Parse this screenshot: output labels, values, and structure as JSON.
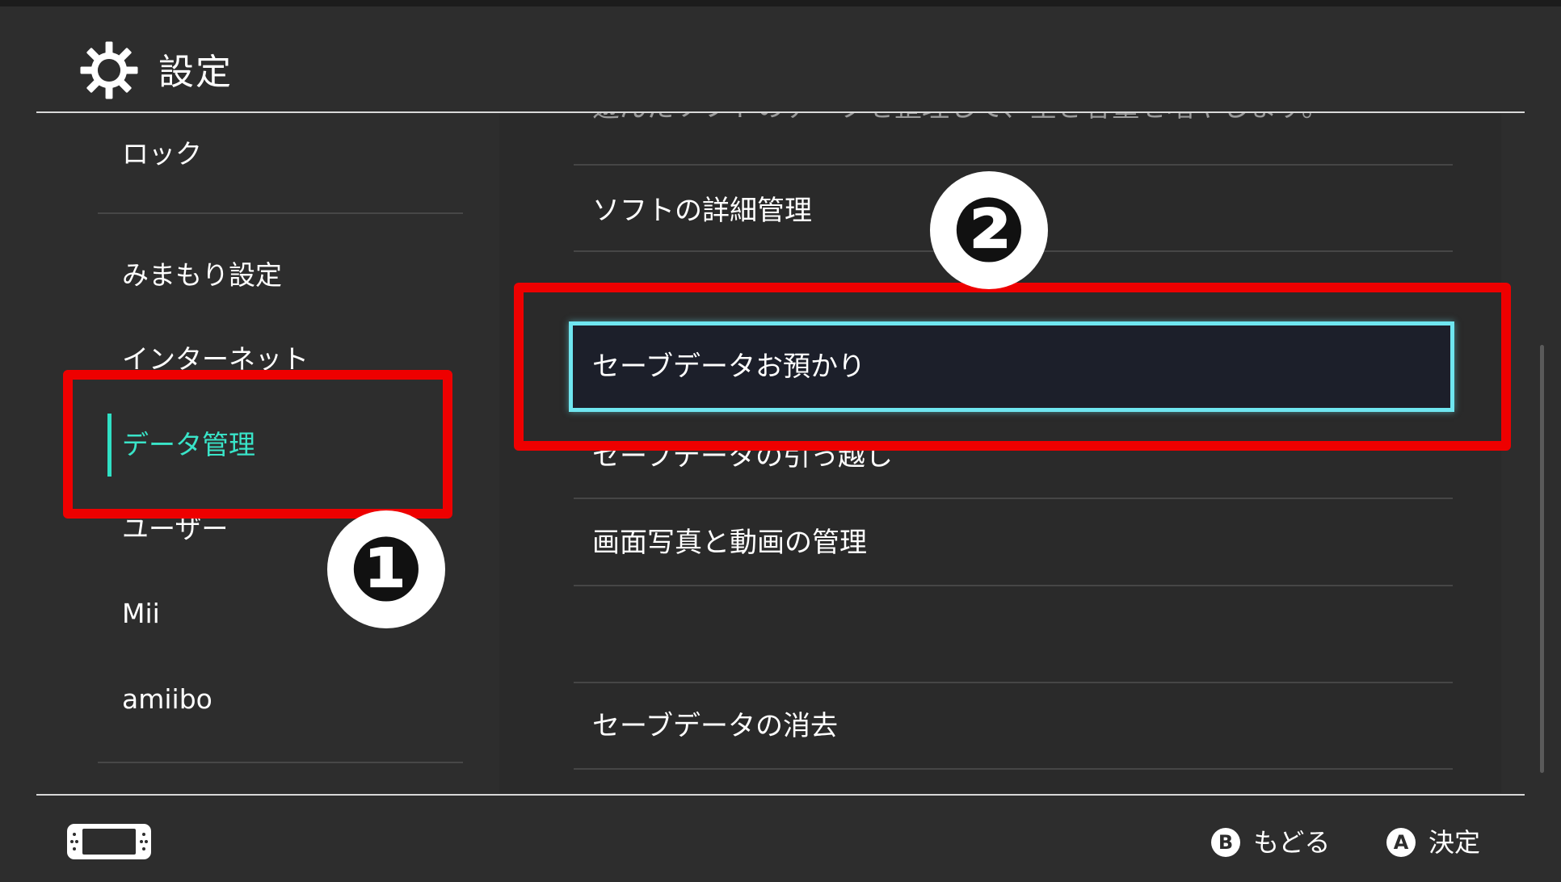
{
  "header": {
    "title": "設定",
    "icon": "gear-icon"
  },
  "sidebar": {
    "items": [
      {
        "label": "ロック"
      },
      {
        "label": "みまもり設定"
      },
      {
        "label": "インターネット"
      },
      {
        "label": "データ管理",
        "active": true
      },
      {
        "label": "ユーザー"
      },
      {
        "label": "Mii"
      },
      {
        "label": "amiibo"
      }
    ]
  },
  "content": {
    "cut_off_text": "遊んだソフトのデータを整理して、空き容量を増やします。",
    "items": [
      {
        "label": "ソフトの詳細管理"
      },
      {
        "label": "セーブデータお預かり",
        "selected": true
      },
      {
        "label": "セーブデータの引っ越し"
      },
      {
        "label": "画面写真と動画の管理"
      },
      {
        "label": "セーブデータの消去"
      }
    ]
  },
  "annotations": {
    "badge1": "❶",
    "badge2": "❷",
    "highlight_color": "#ee0000"
  },
  "footer": {
    "console_icon": "switch-console-icon",
    "back": {
      "button": "B",
      "label": "もどる"
    },
    "confirm": {
      "button": "A",
      "label": "決定"
    }
  },
  "colors": {
    "background": "#2d2d2d",
    "accent": "#39e4c8",
    "selection_border": "#6fe6f0"
  }
}
